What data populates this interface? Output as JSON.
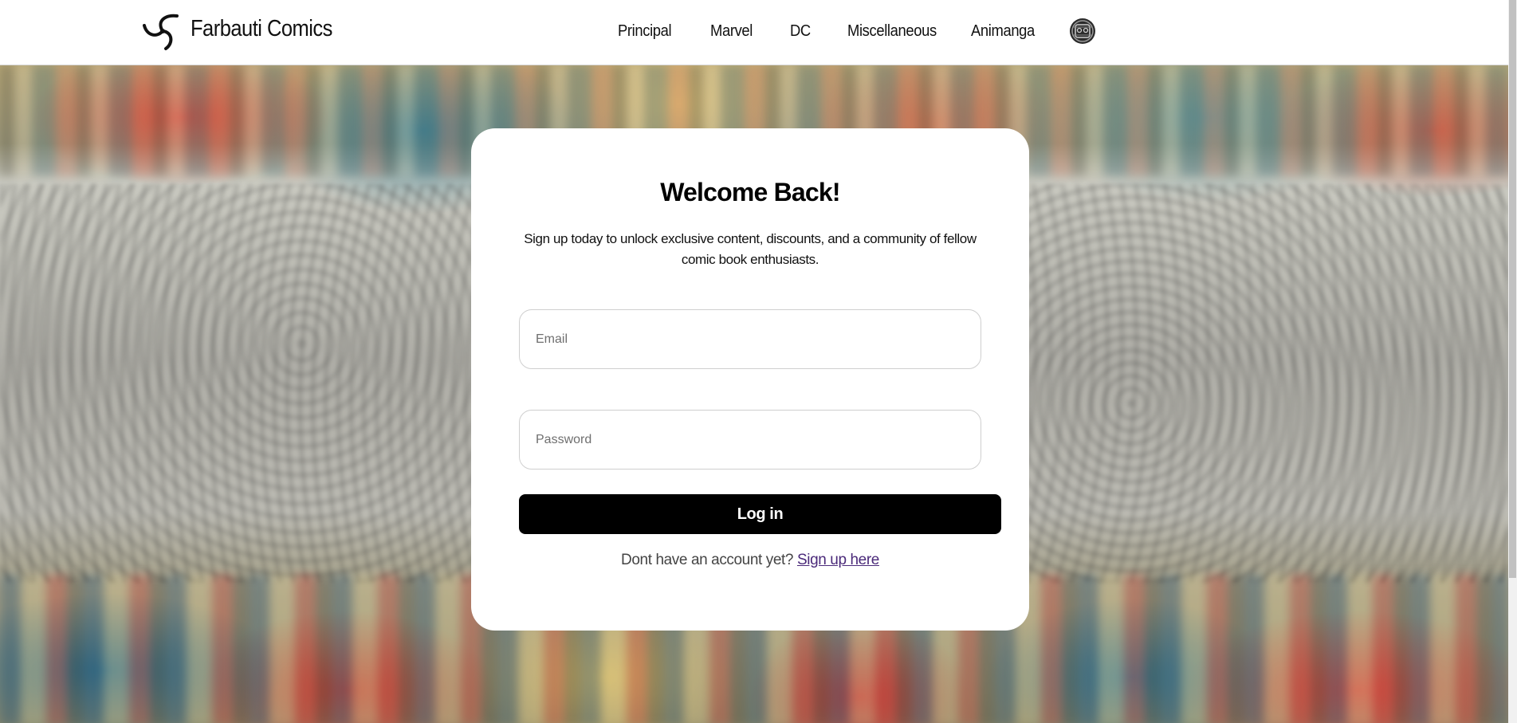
{
  "header": {
    "brand": "Farbauti Comics",
    "nav": [
      "Principal",
      "Marvel",
      "DC",
      "Miscellaneous",
      "Animanga"
    ]
  },
  "card": {
    "title": "Welcome Back!",
    "subtitle": "Sign up today to unlock exclusive content, discounts, and a community of fellow comic book enthusiasts.",
    "email_placeholder": "Email",
    "password_placeholder": "Password",
    "login_label": "Log in",
    "signup_prompt": "Dont have an account yet?",
    "signup_link": "Sign up here"
  },
  "icons": {
    "logo": "triskelion-logo-icon",
    "user": "user-avatar-icon"
  },
  "colors": {
    "header_bg": "#ffffff",
    "card_bg": "#ffffff",
    "button_bg": "#000000",
    "button_text": "#ffffff",
    "link": "#4b2a7a"
  }
}
